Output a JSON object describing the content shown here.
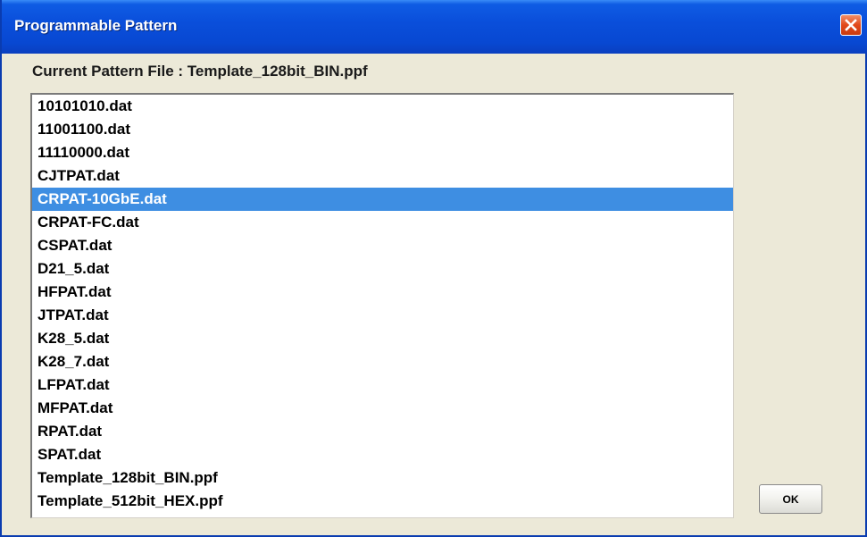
{
  "window": {
    "title": "Programmable Pattern",
    "close_icon": "close-icon"
  },
  "current_file": {
    "label": "Current Pattern File : Template_128bit_BIN.ppf"
  },
  "pattern_list": {
    "selected_index": 4,
    "items": [
      "10101010.dat",
      "11001100.dat",
      "11110000.dat",
      "CJTPAT.dat",
      "CRPAT-10GbE.dat",
      "CRPAT-FC.dat",
      "CSPAT.dat",
      "D21_5.dat",
      "HFPAT.dat",
      "JTPAT.dat",
      "K28_5.dat",
      "K28_7.dat",
      "LFPAT.dat",
      "MFPAT.dat",
      "RPAT.dat",
      "SPAT.dat",
      "Template_128bit_BIN.ppf",
      "Template_512bit_HEX.ppf"
    ]
  },
  "buttons": {
    "ok_label": "OK"
  },
  "colors": {
    "titlebar": "#0a4fdb",
    "selection": "#3e8ee2",
    "dialog_bg": "#ece9d8"
  }
}
